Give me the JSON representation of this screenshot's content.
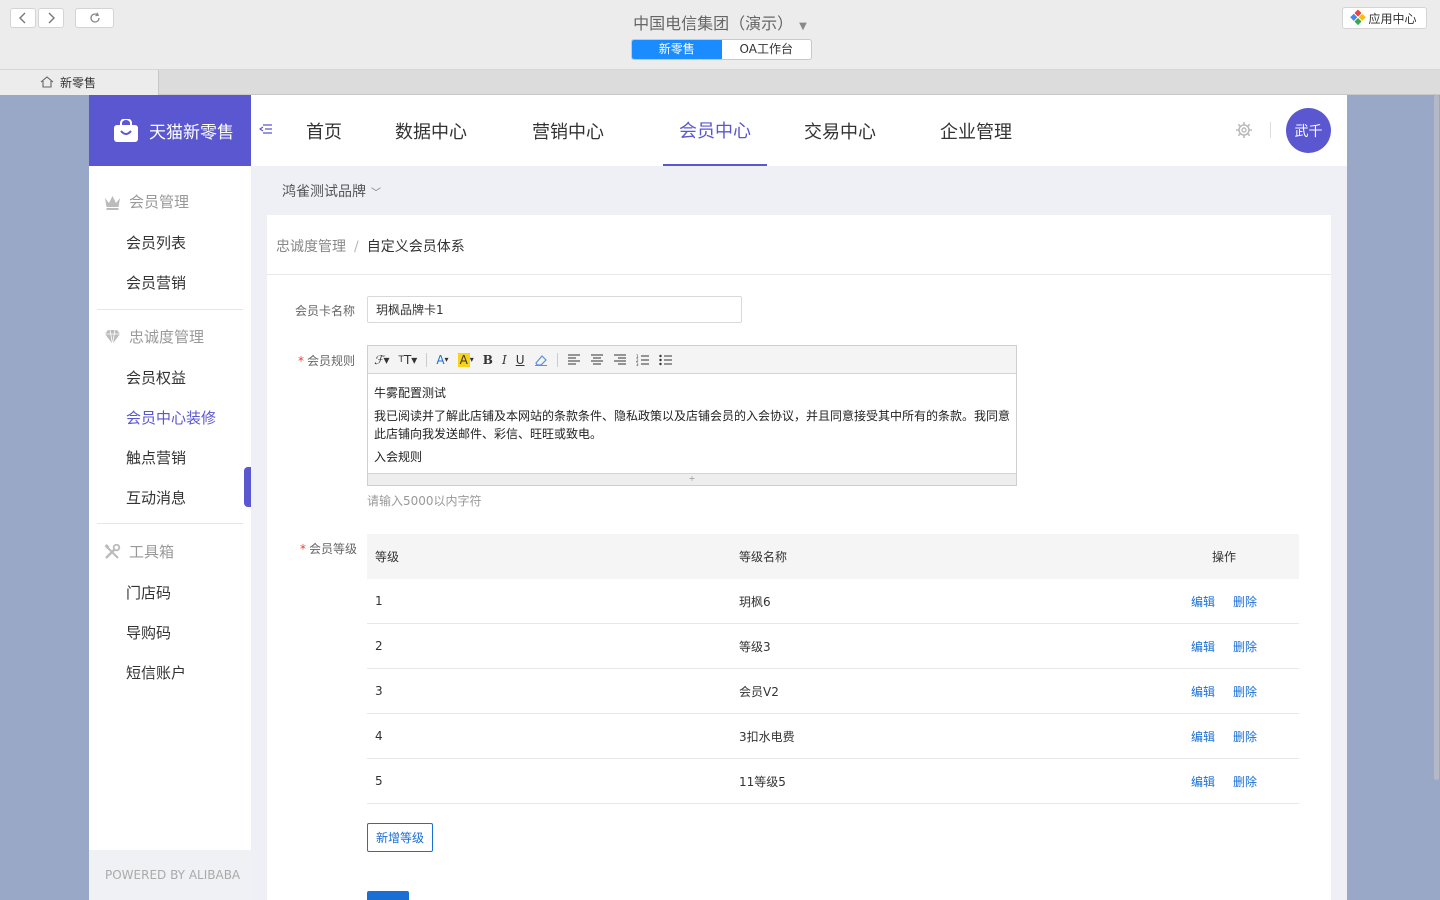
{
  "window": {
    "title": "中国电信集团（演示）",
    "segments": [
      "新零售",
      "OA工作台"
    ],
    "app_center_label": "应用中心",
    "tab_label": "新零售"
  },
  "header": {
    "brand": "天猫新零售",
    "nav": [
      "首页",
      "数据中心",
      "营销中心",
      "会员中心",
      "交易中心",
      "企业管理"
    ],
    "active_nav": "会员中心",
    "avatar_text": "武千"
  },
  "sidebar": {
    "groups": [
      {
        "title": "会员管理",
        "icon": "crown-icon",
        "items": [
          "会员列表",
          "会员营销"
        ]
      },
      {
        "title": "忠诚度管理",
        "icon": "diamond-icon",
        "items": [
          "会员权益",
          "会员中心装修",
          "触点营销",
          "互动消息"
        ]
      },
      {
        "title": "工具箱",
        "icon": "tools-icon",
        "items": [
          "门店码",
          "导购码",
          "短信账户"
        ]
      }
    ],
    "active_item": "会员中心装修",
    "footer": "POWERED BY ALIBABA"
  },
  "content": {
    "brand_selector": "鸿雀测试品牌",
    "breadcrumb": [
      "忠诚度管理",
      "自定义会员体系"
    ],
    "form": {
      "card_name_label": "会员卡名称",
      "card_name_value": "玥枫品牌卡1",
      "rules_label": "会员规则",
      "rules_paragraphs": [
        "牛雾配置测试",
        "我已阅读并了解此店铺及本网站的条款条件、隐私政策以及店铺会员的入会协议，并且同意接受其中所有的条款。我同意此店铺向我发送邮件、彩信、旺旺或致电。",
        "入会规则"
      ],
      "rules_hint": "请输入5000以内字符",
      "levels_label": "会员等级"
    },
    "levels_table": {
      "headers": [
        "等级",
        "等级名称",
        "操作"
      ],
      "rows": [
        {
          "level": "1",
          "name": "玥枫6"
        },
        {
          "level": "2",
          "name": "等级3"
        },
        {
          "level": "3",
          "name": "会员V2"
        },
        {
          "level": "4",
          "name": "3扣水电费"
        },
        {
          "level": "5",
          "name": "11等级5"
        }
      ],
      "actions": [
        "编辑",
        "删除"
      ]
    },
    "add_level_label": "新增等级"
  },
  "colors": {
    "brand": "#5b57d1",
    "link": "#1a6fd4",
    "required": "#f04134"
  }
}
